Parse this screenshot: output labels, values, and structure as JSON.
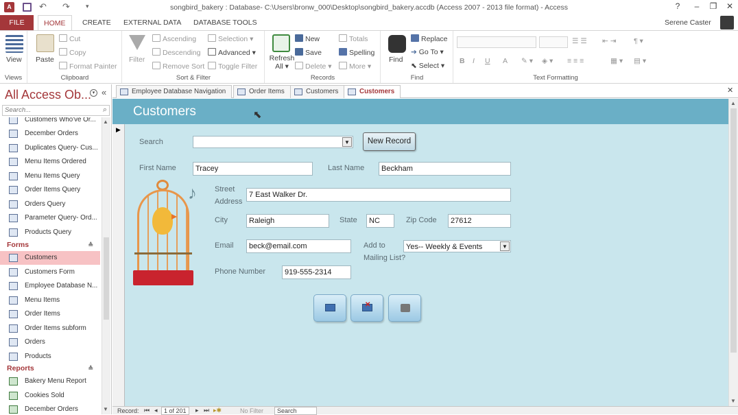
{
  "window": {
    "title": "songbird_bakery : Database- C:\\Users\\bronw_000\\Desktop\\songbird_bakery.accdb (Access 2007 - 2013 file format) - Access",
    "user": "Serene Caster",
    "help": "?"
  },
  "ribbon_tabs": [
    "FILE",
    "HOME",
    "CREATE",
    "EXTERNAL DATA",
    "DATABASE TOOLS"
  ],
  "ribbon": {
    "views": {
      "view": "View",
      "label": "Views"
    },
    "clipboard": {
      "paste": "Paste",
      "cut": "Cut",
      "copy": "Copy",
      "format_painter": "Format Painter",
      "label": "Clipboard"
    },
    "sort_filter": {
      "filter": "Filter",
      "ascending": "Ascending",
      "descending": "Descending",
      "remove_sort": "Remove Sort",
      "selection": "Selection",
      "advanced": "Advanced",
      "toggle_filter": "Toggle Filter",
      "label": "Sort & Filter"
    },
    "records": {
      "refresh": "Refresh",
      "refresh_all": "All",
      "new": "New",
      "save": "Save",
      "delete": "Delete",
      "totals": "Totals",
      "spelling": "Spelling",
      "more": "More",
      "label": "Records"
    },
    "find": {
      "find": "Find",
      "replace": "Replace",
      "goto": "Go To",
      "select": "Select",
      "label": "Find"
    },
    "text_formatting": {
      "bold": "B",
      "italic": "I",
      "underline": "U",
      "font_color": "A",
      "label": "Text Formatting"
    }
  },
  "nav": {
    "title": "All Access Ob...",
    "search_placeholder": "Search...",
    "query_items": [
      "Customers Who've Or...",
      "December Orders",
      "Duplicates Query- Cus...",
      "Menu Items Ordered",
      "Menu Items Query",
      "Order Items Query",
      "Orders Query",
      "Parameter Query- Ord...",
      "Products Query"
    ],
    "forms_label": "Forms",
    "form_items": [
      "Customers",
      "Customers Form",
      "Employee Database N...",
      "Menu Items",
      "Order Items",
      "Order Items  subform",
      "Orders",
      "Products"
    ],
    "reports_label": "Reports",
    "report_items": [
      "Bakery Menu Report",
      "Cookies Sold",
      "December Orders"
    ]
  },
  "doc_tabs": [
    "Employee Database Navigation",
    "Order Items",
    "Customers",
    "Customers"
  ],
  "form": {
    "title": "Customers",
    "search_label": "Search",
    "search_value": "",
    "new_record": "New Record",
    "first_name_label": "First Name",
    "first_name": "Tracey",
    "last_name_label": "Last Name",
    "last_name": "Beckham",
    "street_label_1": "Street",
    "street_label_2": "Address",
    "street": "7 East Walker Dr.",
    "city_label": "City",
    "city": "Raleigh",
    "state_label": "State",
    "state": "NC",
    "zip_label": "Zip Code",
    "zip": "27612",
    "email_label": "Email",
    "email": "beck@email.com",
    "mailing_label_1": "Add to",
    "mailing_label_2": "Mailing List?",
    "mailing": "Yes-- Weekly & Events",
    "phone_label": "Phone Number",
    "phone": "919-555-2314"
  },
  "status": {
    "record_label": "Record:",
    "record_pos": "1 of 201",
    "no_filter": "No Filter",
    "search": "Search"
  },
  "colors": {
    "accent": "#a4373a",
    "form_bg": "#c9e6ed",
    "header_bg": "#6aafc6"
  }
}
